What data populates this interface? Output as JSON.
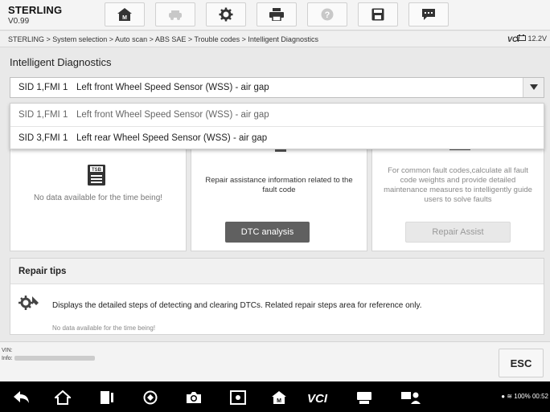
{
  "app": {
    "title": "STERLING",
    "version": "V0.99"
  },
  "breadcrumb": "STERLING > System selection > Auto scan > ABS SAE > Trouble codes > Intelligent Diagnostics",
  "vci_label": "VCI",
  "battery_voltage": "12.2V",
  "section_title": "Intelligent Diagnostics",
  "dropdown": {
    "selected": {
      "code": "SID 1,FMI 1",
      "desc": "Left front Wheel Speed Sensor (WSS) - air gap"
    },
    "options": [
      {
        "code": "SID 1,FMI 1",
        "desc": "Left front Wheel Speed Sensor (WSS) - air gap"
      },
      {
        "code": "SID 3,FMI 1",
        "desc": "Left rear Wheel Speed Sensor (WSS) - air gap"
      }
    ]
  },
  "panels": {
    "tsb": {
      "icon_label": "TSB",
      "text": "No data available for the time being!"
    },
    "dtc": {
      "text": "Repair assistance information related to the fault code",
      "button": "DTC analysis"
    },
    "assist": {
      "text": "For common fault codes,calculate all fault code weights and provide detailed maintenance measures to intelligently guide users to solve faults",
      "button": "Repair Assist"
    }
  },
  "repair_tips": {
    "title": "Repair tips",
    "description": "Displays the detailed steps of detecting and clearing DTCs. Related repair steps area for reference only.",
    "no_data": "No data available for the time being!"
  },
  "footer": {
    "vin_label": "VIN:",
    "info_label": "Info:",
    "esc_label": "ESC"
  },
  "status_bar": {
    "battery": "100%",
    "time": "00:52"
  },
  "icons": {
    "toolbar": [
      "home-icon",
      "vehicle-swap-icon",
      "gear-icon",
      "printer-icon",
      "help-icon",
      "save-icon",
      "message-icon"
    ],
    "nav": [
      "back-icon",
      "home-icon",
      "recent-apps-icon",
      "browser-icon",
      "camera-icon",
      "screenshot-icon",
      "autel-home-icon",
      "vci-icon",
      "data-manager-icon",
      "remote-support-icon"
    ]
  }
}
